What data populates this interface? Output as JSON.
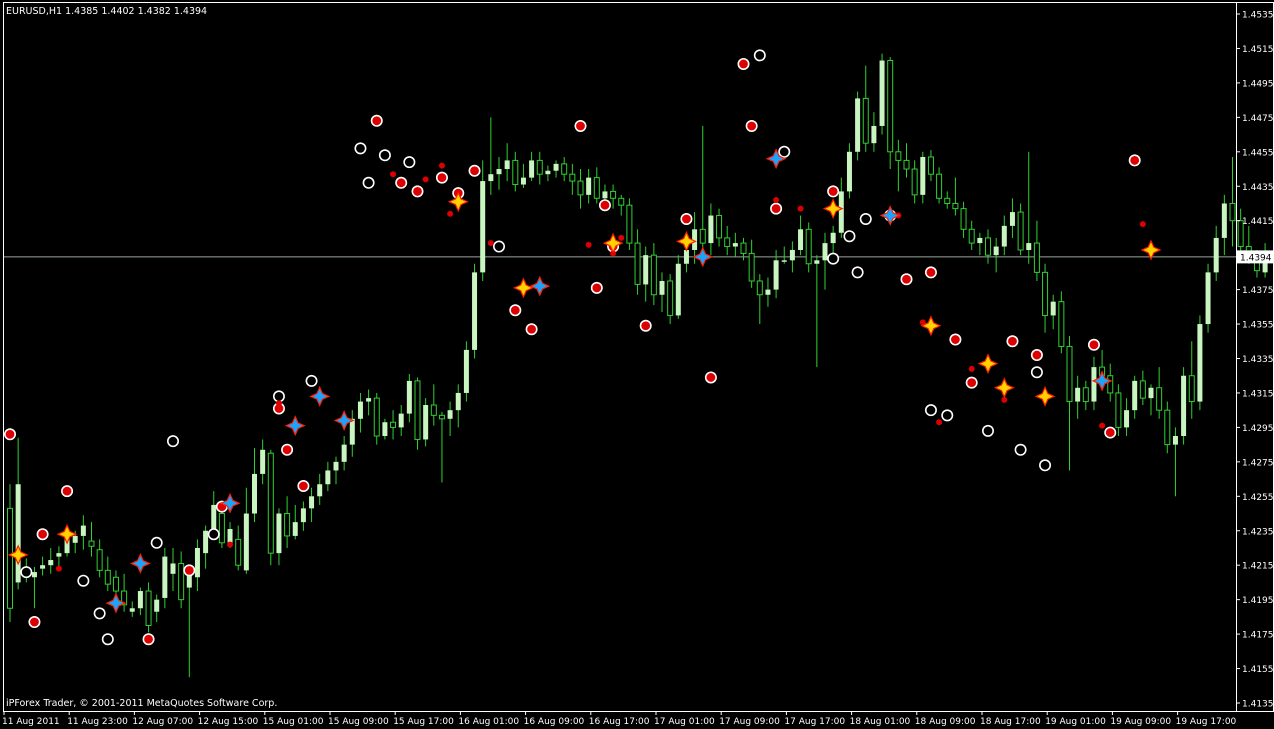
{
  "window": {
    "symbol_info": "EURUSD,H1  1.4385 1.4402 1.4382 1.4394",
    "copyright": "iPForex Trader, © 2001-2011 MetaQuotes Software Corp."
  },
  "colors": {
    "background": "#000000",
    "frame": "#ffffff",
    "bull_body": "#c8f5c0",
    "wick": "#2fd12f",
    "bid_line": "#9aa69a",
    "marker_red": "#dd0000",
    "star_yellow": "#ffd200",
    "star_blue": "#1aa3ff"
  },
  "chart_data": {
    "type": "candlestick",
    "symbol": "EURUSD",
    "timeframe": "H1",
    "current_price": "1.4394",
    "ylim": [
      1.4123,
      1.4541
    ],
    "y_ticks": [
      "1.4535",
      "1.4515",
      "1.4495",
      "1.4475",
      "1.4455",
      "1.4435",
      "1.4415",
      "1.4395",
      "1.4375",
      "1.4355",
      "1.4335",
      "1.4315",
      "1.4295",
      "1.4275",
      "1.4255",
      "1.4235",
      "1.4215",
      "1.4195",
      "1.4175",
      "1.4155",
      "1.4135"
    ],
    "x_ticks": [
      "11 Aug 2011",
      "11 Aug 23:00",
      "12 Aug 07:00",
      "12 Aug 15:00",
      "15 Aug 01:00",
      "15 Aug 09:00",
      "15 Aug 17:00",
      "16 Aug 01:00",
      "16 Aug 09:00",
      "16 Aug 17:00",
      "17 Aug 01:00",
      "17 Aug 09:00",
      "17 Aug 17:00",
      "18 Aug 01:00",
      "18 Aug 09:00",
      "18 Aug 17:00",
      "19 Aug 01:00",
      "19 Aug 09:00",
      "19 Aug 17:00"
    ],
    "bars_per_tick": 8,
    "candles": [
      [
        1.4248,
        1.4262,
        1.4182,
        1.419
      ],
      [
        1.4205,
        1.4289,
        1.4201,
        1.4262
      ],
      [
        1.421,
        1.4219,
        1.4205,
        1.4212
      ],
      [
        1.4208,
        1.4214,
        1.419,
        1.4211
      ],
      [
        1.4213,
        1.422,
        1.4209,
        1.4215
      ],
      [
        1.4215,
        1.4225,
        1.421,
        1.4218
      ],
      [
        1.422,
        1.4226,
        1.4212,
        1.4222
      ],
      [
        1.4222,
        1.4235,
        1.422,
        1.423
      ],
      [
        1.4228,
        1.4235,
        1.4222,
        1.4232
      ],
      [
        1.4232,
        1.4244,
        1.4224,
        1.4238
      ],
      [
        1.4229,
        1.424,
        1.422,
        1.4226
      ],
      [
        1.4224,
        1.423,
        1.4208,
        1.4212
      ],
      [
        1.4212,
        1.422,
        1.42,
        1.4204
      ],
      [
        1.4208,
        1.4212,
        1.4196,
        1.42
      ],
      [
        1.42,
        1.421,
        1.4188,
        1.4192
      ],
      [
        1.4188,
        1.4194,
        1.4185,
        1.419
      ],
      [
        1.419,
        1.4202,
        1.4186,
        1.42
      ],
      [
        1.42,
        1.4205,
        1.4176,
        1.418
      ],
      [
        1.4188,
        1.4198,
        1.4182,
        1.4195
      ],
      [
        1.4196,
        1.4225,
        1.419,
        1.422
      ],
      [
        1.421,
        1.4225,
        1.42,
        1.4216
      ],
      [
        1.4216,
        1.4223,
        1.419,
        1.4195
      ],
      [
        1.4202,
        1.4212,
        1.415,
        1.421
      ],
      [
        1.4208,
        1.423,
        1.42,
        1.4225
      ],
      [
        1.4222,
        1.4238,
        1.4213,
        1.4235
      ],
      [
        1.4235,
        1.4258,
        1.423,
        1.425
      ],
      [
        1.4245,
        1.4252,
        1.4225,
        1.4228
      ],
      [
        1.4228,
        1.424,
        1.4225,
        1.4236
      ],
      [
        1.423,
        1.4238,
        1.4212,
        1.4215
      ],
      [
        1.4212,
        1.426,
        1.421,
        1.4245
      ],
      [
        1.4245,
        1.4283,
        1.424,
        1.4268
      ],
      [
        1.4268,
        1.4288,
        1.4262,
        1.4282
      ],
      [
        1.428,
        1.4282,
        1.4215,
        1.4222
      ],
      [
        1.4222,
        1.4248,
        1.4215,
        1.4245
      ],
      [
        1.4245,
        1.4255,
        1.4225,
        1.4232
      ],
      [
        1.4232,
        1.425,
        1.423,
        1.424
      ],
      [
        1.424,
        1.4252,
        1.4235,
        1.4248
      ],
      [
        1.4248,
        1.426,
        1.424,
        1.4255
      ],
      [
        1.4255,
        1.4268,
        1.425,
        1.4262
      ],
      [
        1.4262,
        1.4275,
        1.4258,
        1.427
      ],
      [
        1.427,
        1.4278,
        1.4262,
        1.4275
      ],
      [
        1.4275,
        1.429,
        1.427,
        1.4285
      ],
      [
        1.4285,
        1.4305,
        1.4278,
        1.43
      ],
      [
        1.43,
        1.4315,
        1.4292,
        1.431
      ],
      [
        1.431,
        1.4317,
        1.4302,
        1.4312
      ],
      [
        1.4312,
        1.4315,
        1.4285,
        1.429
      ],
      [
        1.429,
        1.43,
        1.4288,
        1.4298
      ],
      [
        1.4298,
        1.4305,
        1.4288,
        1.4295
      ],
      [
        1.4295,
        1.4308,
        1.429,
        1.4303
      ],
      [
        1.4303,
        1.4326,
        1.4298,
        1.4322
      ],
      [
        1.4322,
        1.4324,
        1.4282,
        1.4288
      ],
      [
        1.4288,
        1.4312,
        1.4284,
        1.4308
      ],
      [
        1.4308,
        1.432,
        1.4296,
        1.4302
      ],
      [
        1.4302,
        1.4304,
        1.4263,
        1.43
      ],
      [
        1.43,
        1.431,
        1.429,
        1.4305
      ],
      [
        1.4305,
        1.432,
        1.4295,
        1.4315
      ],
      [
        1.4315,
        1.4345,
        1.431,
        1.434
      ],
      [
        1.434,
        1.439,
        1.4335,
        1.4385
      ],
      [
        1.4385,
        1.445,
        1.438,
        1.4438
      ],
      [
        1.4438,
        1.4475,
        1.443,
        1.4442
      ],
      [
        1.4442,
        1.4452,
        1.4433,
        1.4445
      ],
      [
        1.4445,
        1.446,
        1.4438,
        1.445
      ],
      [
        1.445,
        1.4455,
        1.4432,
        1.4436
      ],
      [
        1.4436,
        1.4448,
        1.4434,
        1.444
      ],
      [
        1.444,
        1.4455,
        1.4438,
        1.445
      ],
      [
        1.445,
        1.4455,
        1.4436,
        1.4442
      ],
      [
        1.4442,
        1.4447,
        1.4438,
        1.4444
      ],
      [
        1.4444,
        1.445,
        1.444,
        1.4448
      ],
      [
        1.4448,
        1.4452,
        1.4438,
        1.4442
      ],
      [
        1.4442,
        1.4448,
        1.443,
        1.4438
      ],
      [
        1.4438,
        1.4445,
        1.4422,
        1.443
      ],
      [
        1.443,
        1.4445,
        1.4425,
        1.444
      ],
      [
        1.444,
        1.4446,
        1.4425,
        1.4428
      ],
      [
        1.4428,
        1.4436,
        1.4424,
        1.4432
      ],
      [
        1.4432,
        1.4436,
        1.4422,
        1.4428
      ],
      [
        1.4428,
        1.443,
        1.4418,
        1.4424
      ],
      [
        1.4424,
        1.4428,
        1.4398,
        1.4402
      ],
      [
        1.4402,
        1.441,
        1.4372,
        1.4378
      ],
      [
        1.4378,
        1.44,
        1.4368,
        1.4395
      ],
      [
        1.4395,
        1.4402,
        1.4366,
        1.4372
      ],
      [
        1.4372,
        1.4385,
        1.4362,
        1.438
      ],
      [
        1.438,
        1.4384,
        1.4355,
        1.436
      ],
      [
        1.436,
        1.4395,
        1.4358,
        1.439
      ],
      [
        1.439,
        1.4405,
        1.4385,
        1.4398
      ],
      [
        1.4398,
        1.442,
        1.439,
        1.441
      ],
      [
        1.441,
        1.447,
        1.4395,
        1.4402
      ],
      [
        1.4402,
        1.4425,
        1.4395,
        1.4418
      ],
      [
        1.4418,
        1.4422,
        1.44,
        1.4405
      ],
      [
        1.4405,
        1.4412,
        1.4395,
        1.44
      ],
      [
        1.44,
        1.4408,
        1.4394,
        1.4402
      ],
      [
        1.4402,
        1.4405,
        1.4392,
        1.4396
      ],
      [
        1.4396,
        1.4404,
        1.4376,
        1.438
      ],
      [
        1.438,
        1.4384,
        1.4355,
        1.4372
      ],
      [
        1.4372,
        1.4382,
        1.4365,
        1.4375
      ],
      [
        1.4375,
        1.4398,
        1.437,
        1.4392
      ],
      [
        1.4392,
        1.44,
        1.439,
        1.4392
      ],
      [
        1.4392,
        1.4403,
        1.4385,
        1.4398
      ],
      [
        1.4398,
        1.4418,
        1.4395,
        1.441
      ],
      [
        1.441,
        1.4414,
        1.4385,
        1.439
      ],
      [
        1.439,
        1.4395,
        1.433,
        1.4392
      ],
      [
        1.4392,
        1.4408,
        1.4375,
        1.4402
      ],
      [
        1.4402,
        1.4412,
        1.4395,
        1.4408
      ],
      [
        1.4408,
        1.444,
        1.4405,
        1.4432
      ],
      [
        1.4432,
        1.446,
        1.4428,
        1.4455
      ],
      [
        1.4455,
        1.449,
        1.445,
        1.4486
      ],
      [
        1.4486,
        1.4505,
        1.4455,
        1.446
      ],
      [
        1.446,
        1.4478,
        1.4455,
        1.447
      ],
      [
        1.447,
        1.4512,
        1.4465,
        1.4508
      ],
      [
        1.4508,
        1.451,
        1.4445,
        1.4455
      ],
      [
        1.4455,
        1.4462,
        1.4432,
        1.445
      ],
      [
        1.445,
        1.446,
        1.444,
        1.4445
      ],
      [
        1.4445,
        1.445,
        1.4425,
        1.443
      ],
      [
        1.443,
        1.4455,
        1.4425,
        1.4452
      ],
      [
        1.4452,
        1.4456,
        1.4438,
        1.4442
      ],
      [
        1.4442,
        1.4446,
        1.4425,
        1.4428
      ],
      [
        1.4428,
        1.4432,
        1.4422,
        1.4425
      ],
      [
        1.4425,
        1.444,
        1.4418,
        1.4422
      ],
      [
        1.4422,
        1.4426,
        1.4405,
        1.441
      ],
      [
        1.441,
        1.4415,
        1.4398,
        1.4402
      ],
      [
        1.4402,
        1.4408,
        1.4395,
        1.4405
      ],
      [
        1.4405,
        1.441,
        1.439,
        1.4395
      ],
      [
        1.4395,
        1.4405,
        1.4385,
        1.44
      ],
      [
        1.44,
        1.4418,
        1.4395,
        1.4412
      ],
      [
        1.4412,
        1.4428,
        1.4405,
        1.442
      ],
      [
        1.442,
        1.4425,
        1.4395,
        1.4398
      ],
      [
        1.4398,
        1.4455,
        1.439,
        1.4402
      ],
      [
        1.4402,
        1.4415,
        1.438,
        1.4385
      ],
      [
        1.4385,
        1.439,
        1.435,
        1.436
      ],
      [
        1.436,
        1.4372,
        1.4352,
        1.4368
      ],
      [
        1.4368,
        1.4374,
        1.4338,
        1.4342
      ],
      [
        1.4342,
        1.4348,
        1.427,
        1.431
      ],
      [
        1.431,
        1.4325,
        1.43,
        1.4318
      ],
      [
        1.4318,
        1.4322,
        1.4305,
        1.431
      ],
      [
        1.431,
        1.4336,
        1.4305,
        1.433
      ],
      [
        1.433,
        1.434,
        1.432,
        1.4325
      ],
      [
        1.4325,
        1.4332,
        1.431,
        1.4315
      ],
      [
        1.4315,
        1.432,
        1.429,
        1.4295
      ],
      [
        1.4295,
        1.4312,
        1.429,
        1.4305
      ],
      [
        1.4305,
        1.4325,
        1.43,
        1.4322
      ],
      [
        1.4322,
        1.4328,
        1.4308,
        1.4312
      ],
      [
        1.4312,
        1.432,
        1.4302,
        1.4318
      ],
      [
        1.4318,
        1.433,
        1.43,
        1.4305
      ],
      [
        1.4305,
        1.431,
        1.428,
        1.4285
      ],
      [
        1.4285,
        1.4295,
        1.4255,
        1.429
      ],
      [
        1.429,
        1.433,
        1.4285,
        1.4325
      ],
      [
        1.4325,
        1.4345,
        1.43,
        1.431
      ],
      [
        1.431,
        1.436,
        1.4305,
        1.4355
      ],
      [
        1.4355,
        1.439,
        1.435,
        1.4385
      ],
      [
        1.4385,
        1.4412,
        1.438,
        1.4405
      ],
      [
        1.4405,
        1.443,
        1.4395,
        1.4425
      ],
      [
        1.4425,
        1.4452,
        1.44,
        1.4415
      ],
      [
        1.4415,
        1.4422,
        1.4395,
        1.44
      ],
      [
        1.44,
        1.4412,
        1.439,
        1.4395
      ],
      [
        1.4395,
        1.4398,
        1.4382,
        1.4386
      ],
      [
        1.4385,
        1.4402,
        1.4382,
        1.4394
      ]
    ],
    "markers": {
      "red_circles": [
        [
          0,
          1.4291
        ],
        [
          3,
          1.4182
        ],
        [
          4,
          1.4233
        ],
        [
          7,
          1.4258
        ],
        [
          17,
          1.4172
        ],
        [
          22,
          1.4212
        ],
        [
          26,
          1.4249
        ],
        [
          33,
          1.4306
        ],
        [
          34,
          1.4282
        ],
        [
          36,
          1.4261
        ],
        [
          45,
          1.4473
        ],
        [
          48,
          1.4437
        ],
        [
          50,
          1.4432
        ],
        [
          53,
          1.444
        ],
        [
          55,
          1.4431
        ],
        [
          57,
          1.4444
        ],
        [
          62,
          1.4363
        ],
        [
          64,
          1.4352
        ],
        [
          70,
          1.447
        ],
        [
          72,
          1.4376
        ],
        [
          73,
          1.4424
        ],
        [
          74,
          1.44
        ],
        [
          78,
          1.4354
        ],
        [
          83,
          1.4416
        ],
        [
          86,
          1.4324
        ],
        [
          90,
          1.4506
        ],
        [
          91,
          1.447
        ],
        [
          94,
          1.4422
        ],
        [
          101,
          1.4432
        ],
        [
          108,
          1.4418
        ],
        [
          110,
          1.4381
        ],
        [
          113,
          1.4385
        ],
        [
          116,
          1.4346
        ],
        [
          118,
          1.4321
        ],
        [
          123,
          1.4345
        ],
        [
          126,
          1.4337
        ],
        [
          133,
          1.4343
        ],
        [
          135,
          1.4292
        ],
        [
          138,
          1.445
        ]
      ],
      "white_circles": [
        [
          2,
          1.4211
        ],
        [
          9,
          1.4206
        ],
        [
          11,
          1.4187
        ],
        [
          12,
          1.4172
        ],
        [
          18,
          1.4228
        ],
        [
          20,
          1.4287
        ],
        [
          25,
          1.4233
        ],
        [
          33,
          1.4313
        ],
        [
          37,
          1.4322
        ],
        [
          43,
          1.4457
        ],
        [
          44,
          1.4437
        ],
        [
          46,
          1.4453
        ],
        [
          49,
          1.4449
        ],
        [
          60,
          1.44
        ],
        [
          92,
          1.4511
        ],
        [
          95,
          1.4455
        ],
        [
          101,
          1.4393
        ],
        [
          103,
          1.4406
        ],
        [
          104,
          1.4385
        ],
        [
          105,
          1.4416
        ],
        [
          113,
          1.4305
        ],
        [
          115,
          1.4302
        ],
        [
          120,
          1.4293
        ],
        [
          124,
          1.4282
        ],
        [
          126,
          1.4327
        ],
        [
          127,
          1.4273
        ]
      ],
      "red_dots": [
        [
          6,
          1.4213
        ],
        [
          27,
          1.4227
        ],
        [
          33,
          1.4309
        ],
        [
          47,
          1.4442
        ],
        [
          51,
          1.4439
        ],
        [
          53,
          1.4447
        ],
        [
          54,
          1.4419
        ],
        [
          59,
          1.4402
        ],
        [
          71,
          1.4401
        ],
        [
          74,
          1.4396
        ],
        [
          75,
          1.4405
        ],
        [
          94,
          1.4427
        ],
        [
          97,
          1.4422
        ],
        [
          109,
          1.4418
        ],
        [
          112,
          1.4356
        ],
        [
          114,
          1.4298
        ],
        [
          118,
          1.4329
        ],
        [
          122,
          1.4311
        ],
        [
          134,
          1.4296
        ],
        [
          139,
          1.4413
        ]
      ],
      "yellow_stars": [
        [
          1,
          1.4221
        ],
        [
          7,
          1.4233
        ],
        [
          55,
          1.4426
        ],
        [
          63,
          1.4376
        ],
        [
          74,
          1.4402
        ],
        [
          83,
          1.4403
        ],
        [
          101,
          1.4422
        ],
        [
          113,
          1.4354
        ],
        [
          120,
          1.4332
        ],
        [
          122,
          1.4318
        ],
        [
          127,
          1.4313
        ],
        [
          140,
          1.4398
        ]
      ],
      "blue_stars": [
        [
          13,
          1.4193
        ],
        [
          16,
          1.4216
        ],
        [
          27,
          1.4251
        ],
        [
          35,
          1.4296
        ],
        [
          38,
          1.4313
        ],
        [
          41,
          1.4299
        ],
        [
          65,
          1.4377
        ],
        [
          85,
          1.4394
        ],
        [
          94,
          1.4451
        ],
        [
          108,
          1.4418
        ],
        [
          134,
          1.4322
        ]
      ]
    }
  }
}
